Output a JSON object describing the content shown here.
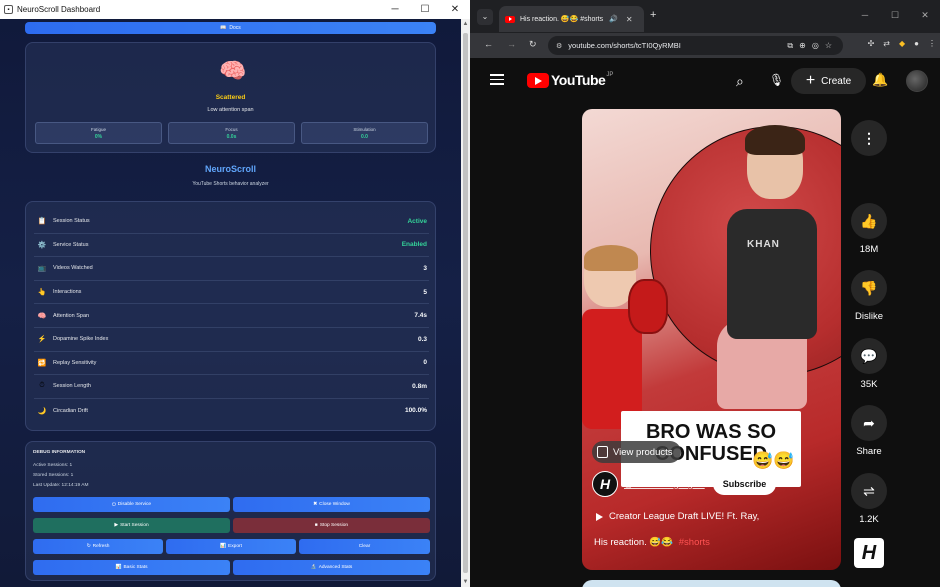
{
  "left_window": {
    "title": "NeuroScroll Dashboard",
    "docs_label": "Docs",
    "state": {
      "emoji": "🧠",
      "label": "Scattered",
      "description": "Low attention span",
      "metrics": [
        {
          "label": "Fatigue",
          "value": "0%"
        },
        {
          "label": "Focus",
          "value": "0.0s"
        },
        {
          "label": "Stimulation",
          "value": "0.0"
        }
      ]
    },
    "brand": {
      "name": "NeuroScroll",
      "tagline": "YouTube Shorts behavior analyzer"
    },
    "stats": [
      {
        "icon": "📋",
        "label": "Session Status",
        "value": "Active",
        "highlight": true
      },
      {
        "icon": "⚙️",
        "label": "Service Status",
        "value": "Enabled",
        "highlight": true
      },
      {
        "icon": "📺",
        "label": "Videos Watched",
        "value": "3"
      },
      {
        "icon": "👆",
        "label": "Interactions",
        "value": "5"
      },
      {
        "icon": "🧠",
        "label": "Attention Span",
        "value": "7.4s"
      },
      {
        "icon": "⚡",
        "label": "Dopamine Spike Index",
        "value": "0.3"
      },
      {
        "icon": "🔁",
        "label": "Replay Sensitivity",
        "value": "0"
      },
      {
        "icon": "⏱",
        "label": "Session Length",
        "value": "0.8m"
      },
      {
        "icon": "🌙",
        "label": "Circadian Drift",
        "value": "100.0%"
      }
    ],
    "debug": {
      "title": "DEBUG INFORMATION",
      "lines": [
        "Active Sessions: 1",
        "Stored Sessions: 1",
        "Last Update: 12:14:19 AM"
      ],
      "buttons": {
        "disable_service": "Disable Service",
        "close_window": "Close Window",
        "start_session": "Start Session",
        "stop_session": "Stop Session",
        "refresh": "Refresh",
        "export": "Export",
        "clear": "Clear",
        "basic_stats": "Basic Stats",
        "advanced_stats": "Advanced Stats"
      }
    }
  },
  "browser": {
    "tab_title": "His reaction. 😅😂 #shorts",
    "url": "youtube.com/shorts/tcTI0QyRMBI",
    "youtube": {
      "logo_text": "YouTube",
      "region": "JP",
      "create_label": "Create",
      "short": {
        "caption": "BRO WAS SO CONFUSED",
        "caption_emoji": "😅😅",
        "view_products": "View products",
        "channel": "@Houseofhighlights",
        "subscribe": "Subscribe",
        "live_text": "Creator League Draft LIVE!  Ft. Ray,",
        "description": "His reaction. 😅😂",
        "hashtag": "#shorts"
      },
      "actions": {
        "likes": "18M",
        "dislike": "Dislike",
        "comments": "35K",
        "share": "Share",
        "remix": "1.2K"
      },
      "channel_logo": "H"
    }
  }
}
